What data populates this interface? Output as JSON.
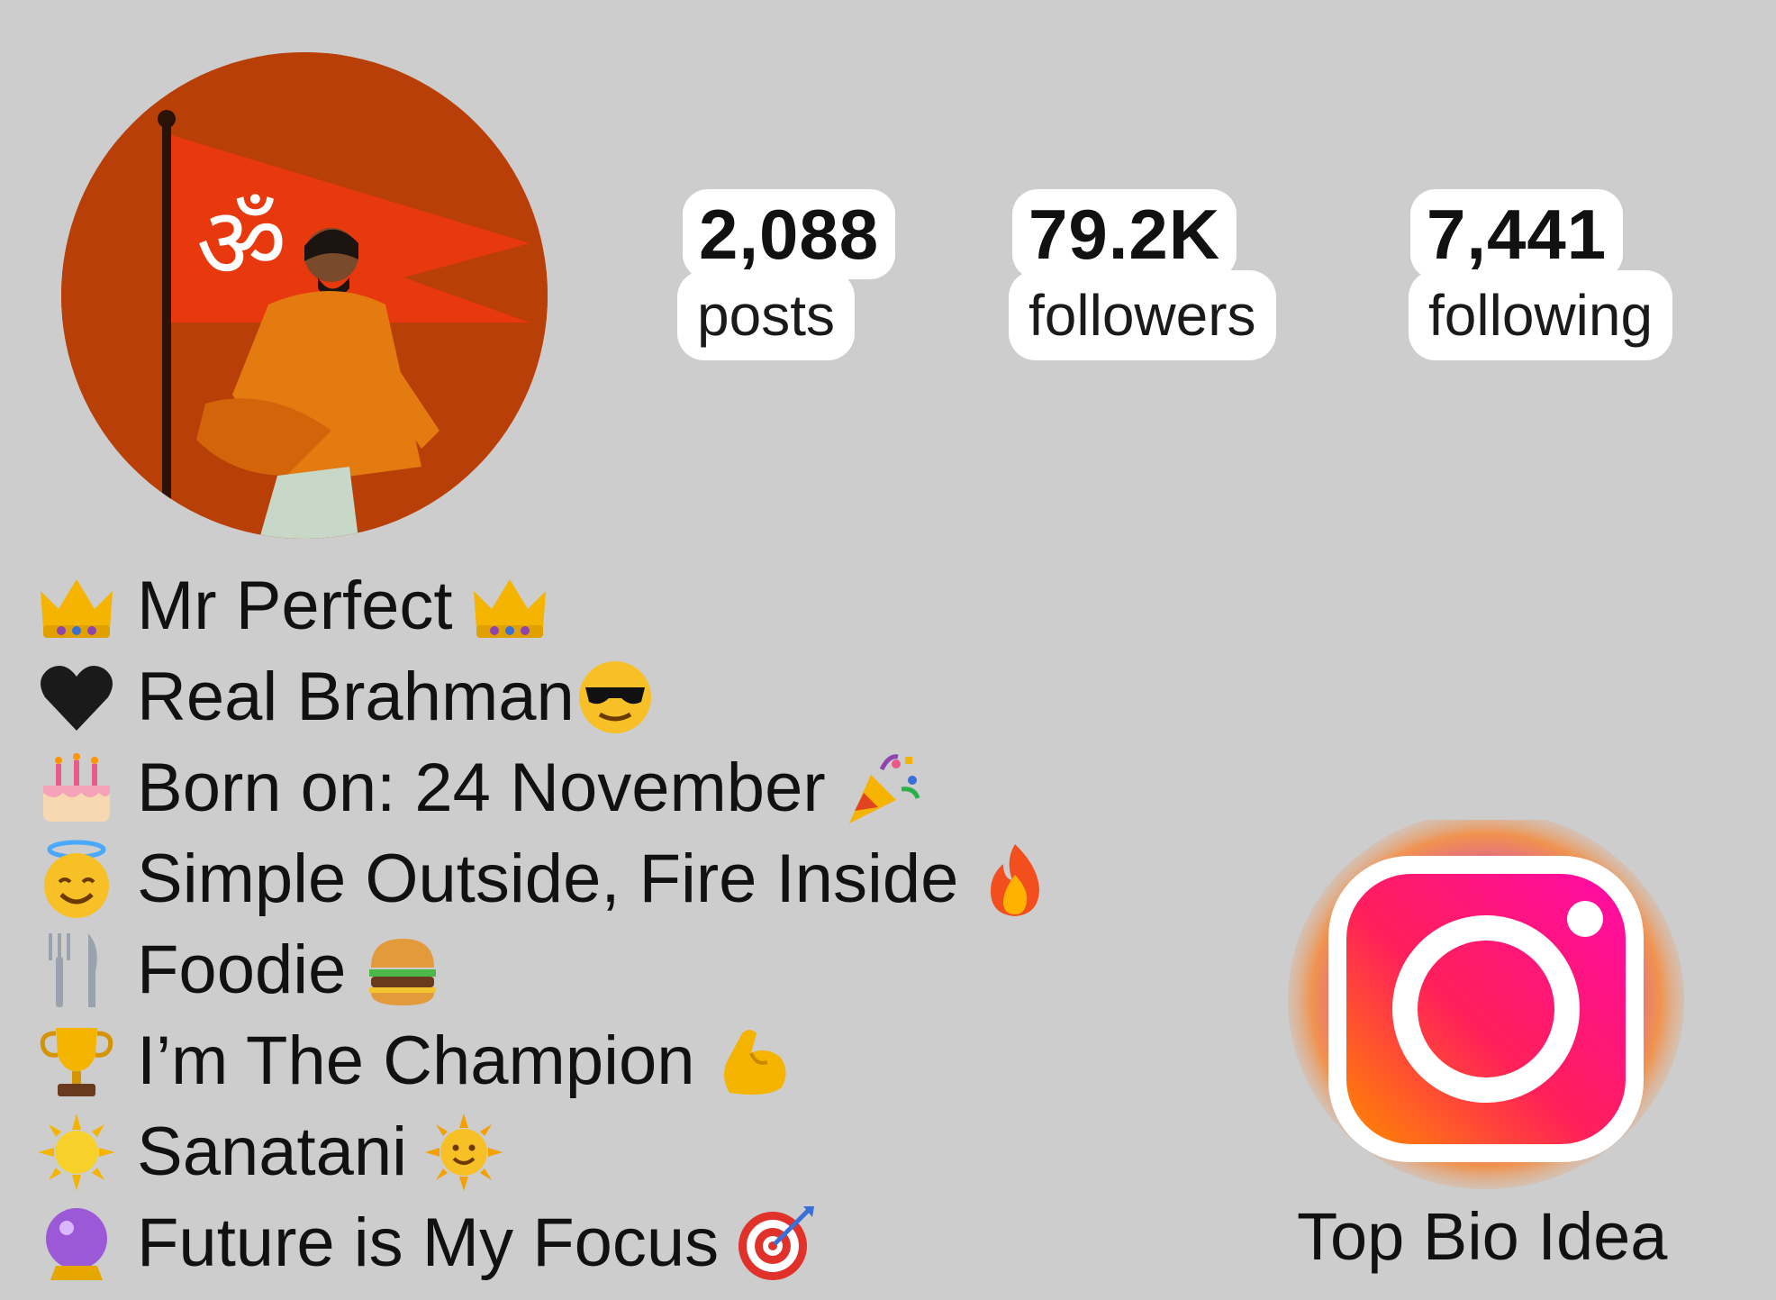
{
  "profile": {
    "avatar_icon": "profile-avatar-saffron-flag-om",
    "stats": [
      {
        "value": "2,088",
        "label": "posts"
      },
      {
        "value": "79.2K",
        "label": "followers"
      },
      {
        "value": "7,441",
        "label": "following"
      }
    ]
  },
  "bio": {
    "lines": [
      {
        "lead_icon": "crown-icon",
        "text": "Mr Perfect",
        "trail_icon": "crown-icon"
      },
      {
        "lead_icon": "black-heart-icon",
        "text": "Real Brahman",
        "trail_icon": "sunglasses-face-icon"
      },
      {
        "lead_icon": "birthday-cake-icon",
        "text": "Born on: 24 November",
        "trail_icon": "party-popper-icon"
      },
      {
        "lead_icon": "halo-face-icon",
        "text": "Simple Outside, Fire Inside",
        "trail_icon": "fire-icon"
      },
      {
        "lead_icon": "fork-knife-icon",
        "text": "Foodie",
        "trail_icon": "burger-icon"
      },
      {
        "lead_icon": "trophy-icon",
        "text": "I’m The Champion",
        "trail_icon": "flexed-biceps-icon"
      },
      {
        "lead_icon": "sun-icon",
        "text": "Sanatani",
        "trail_icon": "sun-face-icon"
      },
      {
        "lead_icon": "crystal-ball-icon",
        "text": "Future is My Focus",
        "trail_icon": "target-icon"
      }
    ]
  },
  "branding": {
    "logo_icon": "instagram-logo-icon",
    "caption": "Top Bio Idea"
  },
  "colors": {
    "background": "#cdcdcd",
    "avatar_bg": "#b83f08",
    "flag": "#e8380d",
    "instagram_pink": "#ff0a8a",
    "instagram_orange": "#ff6a00"
  }
}
